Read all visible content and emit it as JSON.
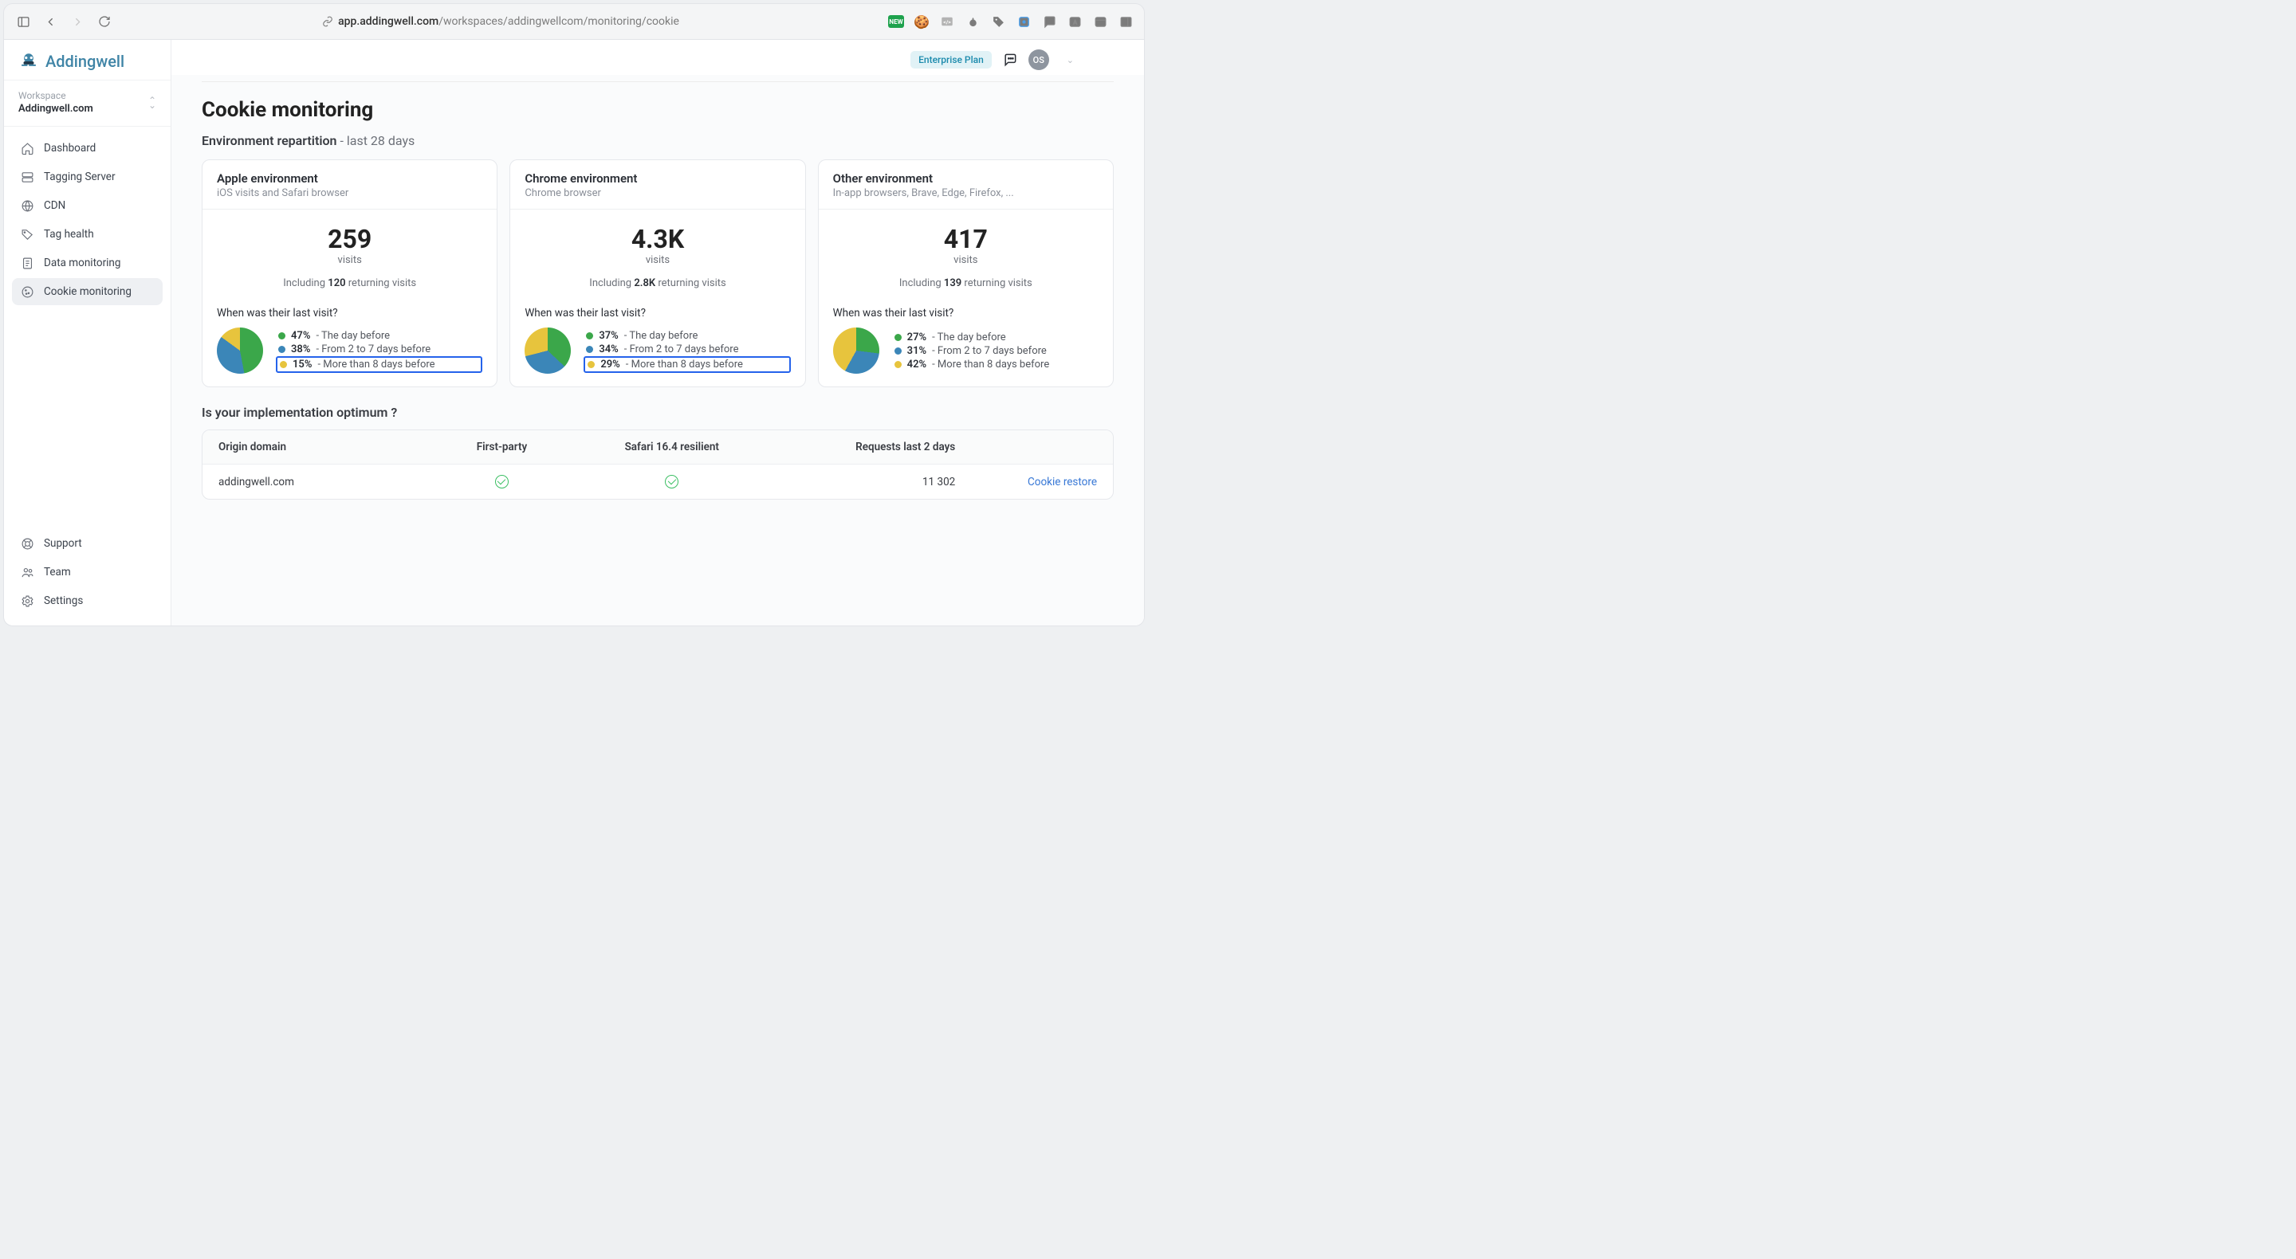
{
  "url": {
    "host": "app.addingwell.com",
    "path": "/workspaces/addingwellcom/monitoring/cookie"
  },
  "brand": "Addingwell",
  "workspace": {
    "label": "Workspace",
    "name": "Addingwell.com"
  },
  "nav": {
    "dashboard": "Dashboard",
    "tagging": "Tagging Server",
    "cdn": "CDN",
    "taghealth": "Tag health",
    "datamon": "Data monitoring",
    "cookiemon": "Cookie monitoring",
    "support": "Support",
    "team": "Team",
    "settings": "Settings"
  },
  "topbar": {
    "plan": "Enterprise Plan",
    "avatar": "OS"
  },
  "page": {
    "title": "Cookie monitoring",
    "section": "Environment repartition",
    "period": " - last 28 days",
    "impl_title": "Is your implementation optimum ?"
  },
  "cards": [
    {
      "title": "Apple environment",
      "desc": "iOS visits and Safari browser",
      "value": "259",
      "unit": "visits",
      "incl_pre": "Including ",
      "incl_num": "120",
      "incl_post": " returning visits",
      "question": "When was their last visit?",
      "slices": [
        47,
        38,
        15
      ],
      "legend": [
        {
          "pct": "47%",
          "text": " - The day before",
          "color": "#3ba74a"
        },
        {
          "pct": "38%",
          "text": " - From 2 to 7 days before",
          "color": "#3b86b8"
        },
        {
          "pct": "15%",
          "text": " - More than 8 days before",
          "color": "#e7c43d",
          "boxed": true
        }
      ]
    },
    {
      "title": "Chrome environment",
      "desc": "Chrome browser",
      "value": "4.3K",
      "unit": "visits",
      "incl_pre": "Including ",
      "incl_num": "2.8K",
      "incl_post": " returning visits",
      "question": "When was their last visit?",
      "slices": [
        37,
        34,
        29
      ],
      "legend": [
        {
          "pct": "37%",
          "text": " - The day before",
          "color": "#3ba74a"
        },
        {
          "pct": "34%",
          "text": " - From 2 to 7 days before",
          "color": "#3b86b8"
        },
        {
          "pct": "29%",
          "text": " - More than 8 days before",
          "color": "#e7c43d",
          "boxed": true
        }
      ]
    },
    {
      "title": "Other environment",
      "desc": "In-app browsers, Brave, Edge, Firefox, ...",
      "value": "417",
      "unit": "visits",
      "incl_pre": "Including ",
      "incl_num": "139",
      "incl_post": " returning visits",
      "question": "When was their last visit?",
      "slices": [
        27,
        31,
        42
      ],
      "legend": [
        {
          "pct": "27%",
          "text": " - The day before",
          "color": "#3ba74a"
        },
        {
          "pct": "31%",
          "text": " - From 2 to 7 days before",
          "color": "#3b86b8"
        },
        {
          "pct": "42%",
          "text": " - More than 8 days before",
          "color": "#e7c43d"
        }
      ]
    }
  ],
  "table": {
    "headers": {
      "c1": "Origin domain",
      "c2": "First-party",
      "c3": "Safari 16.4 resilient",
      "c4": "Requests last 2 days",
      "c5": ""
    },
    "rows": [
      {
        "domain": "addingwell.com",
        "requests": "11 302",
        "action": "Cookie restore"
      }
    ]
  },
  "colors": {
    "green": "#3ba74a",
    "blue": "#3b86b8",
    "yellow": "#e7c43d"
  },
  "chart_data": [
    {
      "type": "pie",
      "title": "Apple environment - last visit",
      "categories": [
        "The day before",
        "From 2 to 7 days before",
        "More than 8 days before"
      ],
      "values": [
        47,
        38,
        15
      ]
    },
    {
      "type": "pie",
      "title": "Chrome environment - last visit",
      "categories": [
        "The day before",
        "From 2 to 7 days before",
        "More than 8 days before"
      ],
      "values": [
        37,
        34,
        29
      ]
    },
    {
      "type": "pie",
      "title": "Other environment - last visit",
      "categories": [
        "The day before",
        "From 2 to 7 days before",
        "More than 8 days before"
      ],
      "values": [
        27,
        31,
        42
      ]
    }
  ]
}
